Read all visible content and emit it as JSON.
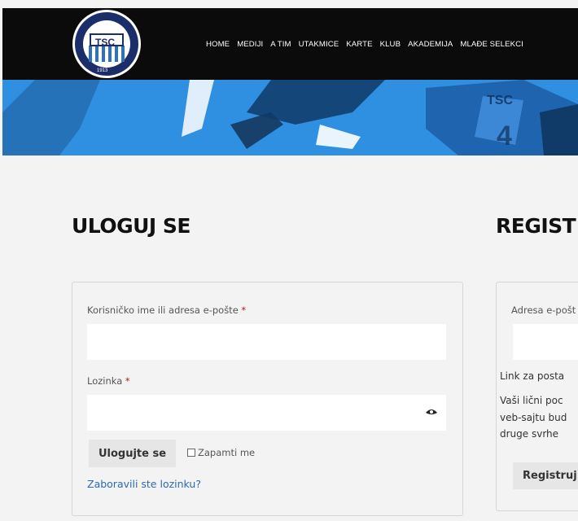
{
  "header": {
    "logo_alt": "TSC Bačka Topola",
    "logo_text": {
      "center": "TSC",
      "arc": "BAČKA TOPOLA / TOPOLYA",
      "year": "1913"
    },
    "nav": [
      "HOME",
      "MEDIJI",
      "A TIM",
      "UTAKMICE",
      "KARTE",
      "KLUB",
      "AKADEMIJA",
      "MLAĐE SELEKCI"
    ]
  },
  "login": {
    "title": "ULOGUJ SE",
    "username_label": "Korisničko ime ili adresa e-pošte",
    "required_mark": "*",
    "password_label": "Lozinka",
    "submit_label": "Ulogujte se",
    "remember_label": "Zapamti me",
    "forgot_link": "Zaboravili ste lozinku?"
  },
  "register": {
    "title": "REGIST",
    "email_label": "Adresa e-pošt",
    "info_line1": "Link za posta",
    "info_line2": "Vaši lični poc",
    "info_line3": "veb-sajtu bud",
    "info_line4": "druge svrhe",
    "submit_label": "Registruj"
  },
  "colors": {
    "header_bg": "#0b0b0b",
    "hero": "#2f8fe0",
    "link": "#2a6bb4",
    "required": "#a4201f"
  }
}
